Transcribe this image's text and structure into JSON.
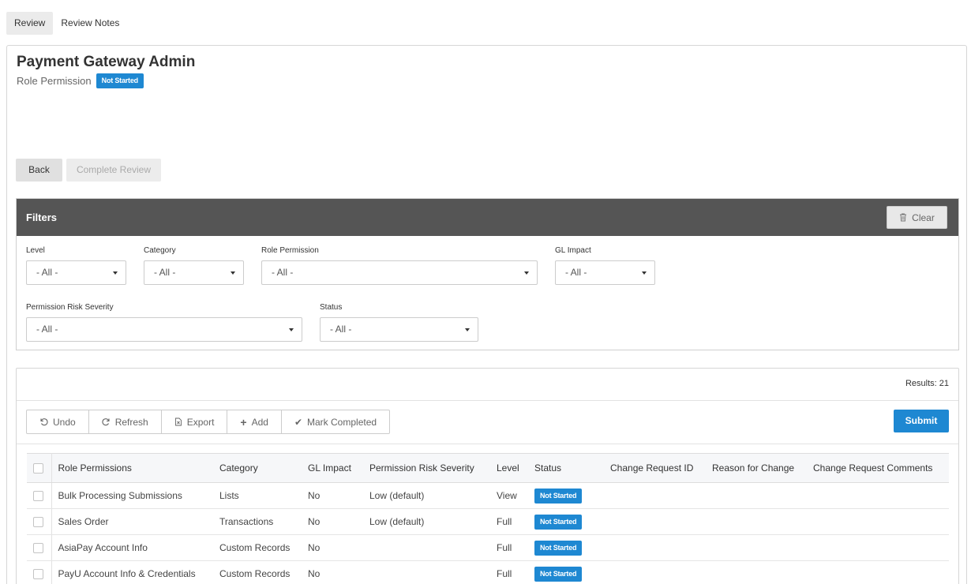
{
  "tabs": [
    {
      "label": "Review",
      "active": true
    },
    {
      "label": "Review Notes",
      "active": false
    }
  ],
  "header": {
    "title": "Payment Gateway Admin",
    "subtitle": "Role Permission",
    "status_badge": "Not Started"
  },
  "actions": {
    "back_label": "Back",
    "complete_label": "Complete Review"
  },
  "filters": {
    "title": "Filters",
    "clear_label": "Clear",
    "level": {
      "label": "Level",
      "value": "- All -"
    },
    "category": {
      "label": "Category",
      "value": "- All -"
    },
    "role_permission": {
      "label": "Role Permission",
      "value": "- All -"
    },
    "gl_impact": {
      "label": "GL Impact",
      "value": "- All -"
    },
    "risk_severity": {
      "label": "Permission Risk Severity",
      "value": "- All -"
    },
    "status": {
      "label": "Status",
      "value": "- All -"
    }
  },
  "results": {
    "count_text": "Results: 21",
    "toolbar": {
      "undo": "Undo",
      "refresh": "Refresh",
      "export": "Export",
      "add": "Add",
      "mark_completed": "Mark Completed"
    },
    "submit_label": "Submit",
    "columns": [
      "Role Permissions",
      "Category",
      "GL Impact",
      "Permission Risk Severity",
      "Level",
      "Status",
      "Change Request ID",
      "Reason for Change",
      "Change Request Comments"
    ],
    "rows": [
      {
        "permission": "Bulk Processing Submissions",
        "category": "Lists",
        "gl_impact": "No",
        "risk": "Low (default)",
        "level": "View",
        "status": "Not Started",
        "cr_id": "",
        "reason": "",
        "comments": ""
      },
      {
        "permission": "Sales Order",
        "category": "Transactions",
        "gl_impact": "No",
        "risk": "Low (default)",
        "level": "Full",
        "status": "Not Started",
        "cr_id": "",
        "reason": "",
        "comments": ""
      },
      {
        "permission": "AsiaPay Account Info",
        "category": "Custom Records",
        "gl_impact": "No",
        "risk": "",
        "level": "Full",
        "status": "Not Started",
        "cr_id": "",
        "reason": "",
        "comments": ""
      },
      {
        "permission": "PayU Account Info & Credentials",
        "category": "Custom Records",
        "gl_impact": "No",
        "risk": "",
        "level": "Full",
        "status": "Not Started",
        "cr_id": "",
        "reason": "",
        "comments": ""
      }
    ]
  },
  "colors": {
    "accent": "#1e88d2",
    "filters_header": "#555555"
  }
}
